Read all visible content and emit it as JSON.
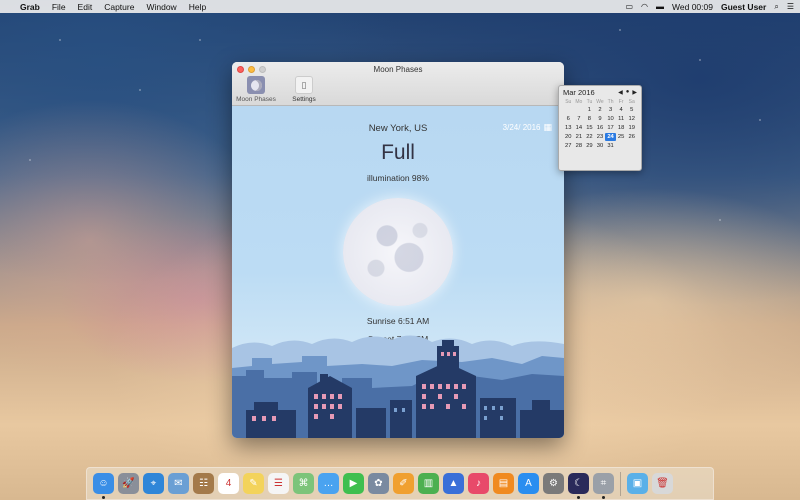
{
  "menubar": {
    "apple": "",
    "app_name": "Grab",
    "items": [
      "File",
      "Edit",
      "Capture",
      "Window",
      "Help"
    ],
    "clock": "Wed 00:09",
    "user": "Guest User"
  },
  "window": {
    "title": "Moon Phases",
    "toolbar": {
      "moon_phases_label": "Moon Phases",
      "settings_label": "Settings"
    },
    "location": "New York, US",
    "date": "3/24/ 2016",
    "phase": "Full",
    "illumination": "illumination 98%",
    "sunrise": "Sunrise 6:51 AM",
    "sunset": "Sunset 7:12 PM"
  },
  "calendar": {
    "month_label": "Mar 2016",
    "weekdays": [
      "Su",
      "Mo",
      "Tu",
      "We",
      "Th",
      "Fr",
      "Sa"
    ],
    "rows": [
      [
        "",
        "",
        "1",
        "2",
        "3",
        "4",
        "5"
      ],
      [
        "6",
        "7",
        "8",
        "9",
        "10",
        "11",
        "12"
      ],
      [
        "13",
        "14",
        "15",
        "16",
        "17",
        "18",
        "19"
      ],
      [
        "20",
        "21",
        "22",
        "23",
        "24",
        "25",
        "26"
      ],
      [
        "27",
        "28",
        "29",
        "30",
        "31",
        "",
        ""
      ]
    ],
    "selected": "24"
  },
  "dock": {
    "icons": [
      {
        "name": "finder-icon",
        "glyph": "☺",
        "color": "#3a8ee6",
        "running": true
      },
      {
        "name": "launchpad-icon",
        "glyph": "🚀",
        "color": "#8a8f99",
        "running": false
      },
      {
        "name": "safari-icon",
        "glyph": "⌖",
        "color": "#2f86d8",
        "running": false
      },
      {
        "name": "mail-icon",
        "glyph": "✉",
        "color": "#6a9fd4",
        "running": false
      },
      {
        "name": "contacts-icon",
        "glyph": "☷",
        "color": "#a47a4a",
        "running": false
      },
      {
        "name": "calendar-icon",
        "glyph": "4",
        "color": "#ffffff",
        "running": false
      },
      {
        "name": "notes-icon",
        "glyph": "✎",
        "color": "#f3d35b",
        "running": false
      },
      {
        "name": "reminders-icon",
        "glyph": "☰",
        "color": "#f5f5f5",
        "running": false
      },
      {
        "name": "maps-icon",
        "glyph": "⌘",
        "color": "#7cc47a",
        "running": false
      },
      {
        "name": "messages-icon",
        "glyph": "…",
        "color": "#4aa3f0",
        "running": false
      },
      {
        "name": "facetime-icon",
        "glyph": "▶",
        "color": "#3fbf4f",
        "running": false
      },
      {
        "name": "photos-icon",
        "glyph": "✿",
        "color": "#7a8aa0",
        "running": false
      },
      {
        "name": "pages-icon",
        "glyph": "✐",
        "color": "#f0a030",
        "running": false
      },
      {
        "name": "numbers-icon",
        "glyph": "▥",
        "color": "#4cb050",
        "running": false
      },
      {
        "name": "keynote-icon",
        "glyph": "▲",
        "color": "#3a6fd8",
        "running": false
      },
      {
        "name": "itunes-icon",
        "glyph": "♪",
        "color": "#e84a6a",
        "running": false
      },
      {
        "name": "ibooks-icon",
        "glyph": "▤",
        "color": "#f08a20",
        "running": false
      },
      {
        "name": "app-store-icon",
        "glyph": "A",
        "color": "#2a8ef0",
        "running": false
      },
      {
        "name": "system-preferences-icon",
        "glyph": "⚙",
        "color": "#7a7a7a",
        "running": false
      },
      {
        "name": "moon-phases-icon",
        "glyph": "☾",
        "color": "#2a2a5a",
        "running": true
      },
      {
        "name": "grab-icon",
        "glyph": "⌗",
        "color": "#9aa0a8",
        "running": true
      },
      {
        "name": "downloads-folder-icon",
        "glyph": "▣",
        "color": "#5ab0e8",
        "running": false
      },
      {
        "name": "trash-icon",
        "glyph": "🗑",
        "color": "#d8d8d8",
        "running": false
      }
    ]
  }
}
